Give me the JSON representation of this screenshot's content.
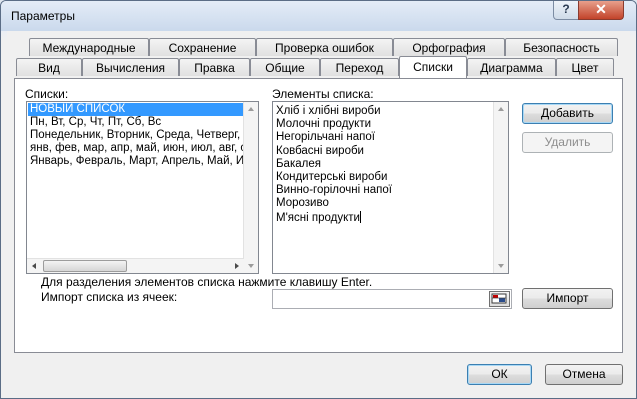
{
  "window": {
    "title": "Параметры",
    "help_label": "?",
    "close_label": "✕"
  },
  "tabs_row1": [
    {
      "label": "Международные"
    },
    {
      "label": "Сохранение"
    },
    {
      "label": "Проверка ошибок"
    },
    {
      "label": "Орфография"
    },
    {
      "label": "Безопасность"
    }
  ],
  "tabs_row2": [
    {
      "label": "Вид"
    },
    {
      "label": "Вычисления"
    },
    {
      "label": "Правка"
    },
    {
      "label": "Общие"
    },
    {
      "label": "Переход"
    },
    {
      "label": "Списки",
      "active": true
    },
    {
      "label": "Диаграмма"
    },
    {
      "label": "Цвет"
    }
  ],
  "lists": {
    "label": "Списки:",
    "items": [
      "НОВЫЙ СПИСОК",
      "Пн, Вт, Ср, Чт, Пт, Сб, Вс",
      "Понедельник, Вторник, Среда, Четверг, Пятница, Суббота, Воскресенье",
      "янв, фев, мар, апр, май, июн, июл, авг, сен, окт, ноя, дек",
      "Январь, Февраль, Март, Апрель, Май, Июнь, Июль, Август, Сентябрь, Октябрь, Ноябрь, Декабрь"
    ],
    "selected_index": 0
  },
  "elements": {
    "label": "Элементы списка:",
    "items": [
      "Хлiб i хлiбнi вироби",
      "Молочнi продукти",
      "Негорiльчанi напої",
      "Ковбаснi вироби",
      "Бакалея",
      "Кондитерськi вироби",
      "Винно-горiлочнi напої",
      "Морозиво",
      "М'яснi продукти"
    ]
  },
  "buttons": {
    "add": "Добавить",
    "delete": "Удалить",
    "import": "Импорт",
    "ok": "ОК",
    "cancel": "Отмена"
  },
  "hint_text": "Для разделения элементов списка нажмите клавишу Enter.",
  "import_label": "Импорт списка из ячеек:",
  "import_value": ""
}
